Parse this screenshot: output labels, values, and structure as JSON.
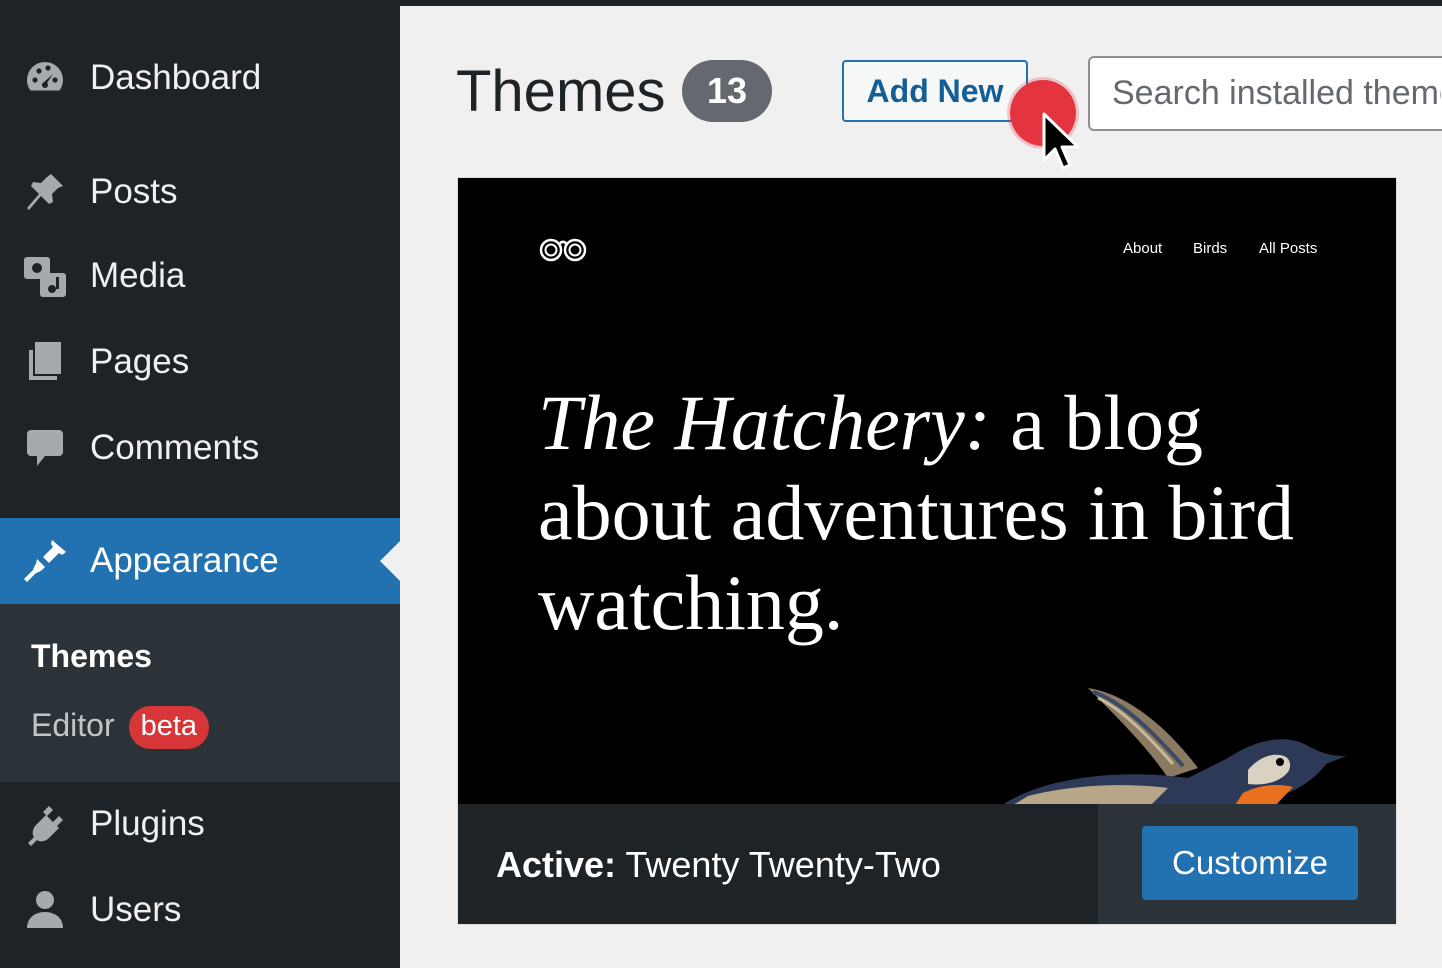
{
  "sidebar": {
    "items": [
      {
        "label": "Dashboard",
        "icon": "dashboard-icon"
      },
      {
        "label": "Posts",
        "icon": "pin-icon"
      },
      {
        "label": "Media",
        "icon": "media-icon"
      },
      {
        "label": "Pages",
        "icon": "pages-icon"
      },
      {
        "label": "Comments",
        "icon": "comment-icon"
      },
      {
        "label": "Appearance",
        "icon": "paintbrush-icon"
      },
      {
        "label": "Plugins",
        "icon": "plug-icon"
      },
      {
        "label": "Users",
        "icon": "user-icon"
      }
    ],
    "submenu": {
      "themes": "Themes",
      "editor": "Editor",
      "editor_badge": "beta"
    }
  },
  "header": {
    "title": "Themes",
    "count": "13",
    "add_new": "Add New",
    "search_placeholder": "Search installed themes..."
  },
  "theme": {
    "preview": {
      "nav": [
        "About",
        "Birds",
        "All Posts"
      ],
      "headline_italic": "The Hatchery:",
      "headline_rest": " a blog about adventures in bird watching."
    },
    "active_label": "Active:",
    "name": "Twenty Twenty-Two",
    "customize": "Customize"
  },
  "colors": {
    "accent": "#2271b1",
    "sidebar_bg": "#1d2327",
    "badge_red": "#d63638",
    "cursor_dot": "#e3343f"
  }
}
